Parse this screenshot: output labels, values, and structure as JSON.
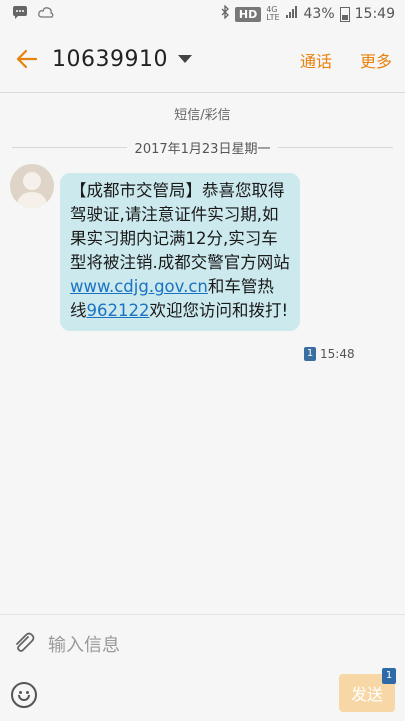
{
  "status_bar": {
    "hd": "HD",
    "lte_top": "4G",
    "lte_bottom": "LTE",
    "battery": "43%",
    "time": "15:49"
  },
  "app_bar": {
    "contact": "10639910",
    "call_label": "通话",
    "more_label": "更多"
  },
  "conversation": {
    "type_label": "短信/彩信",
    "date": "2017年1月23日星期一",
    "message": {
      "part1": "【成都市交管局】恭喜您取得驾驶证,请注意证件实习期,如果实习期内记满12分,实习车型将被注销.成都交警官方网站",
      "link": "www.cdjg.gov.cn",
      "part2": "和车管热线",
      "phone": "962122",
      "part3": "欢迎您访问和拨打!",
      "sim": "1",
      "time": "15:48"
    }
  },
  "composer": {
    "placeholder": "输入信息",
    "send_label": "发送",
    "send_sim": "1"
  },
  "colors": {
    "accent": "#e8820c",
    "bubble": "#cce9ed",
    "link": "#1a73c2"
  }
}
